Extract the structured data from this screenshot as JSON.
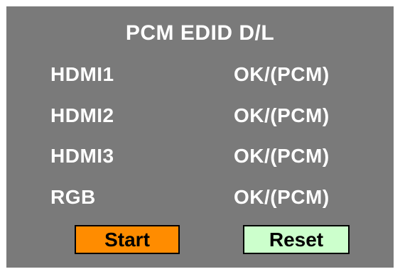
{
  "panel": {
    "title": "PCM EDID D/L",
    "background": "#7a7a7a"
  },
  "rows": [
    {
      "port": "HDMI1",
      "status": "OK/(PCM)"
    },
    {
      "port": "HDMI2",
      "status": "OK/(PCM)"
    },
    {
      "port": "HDMI3",
      "status": "OK/(PCM)"
    },
    {
      "port": "RGB",
      "status": "OK/(PCM)"
    }
  ],
  "buttons": {
    "start_label": "Start",
    "start_color": "#ff8c00",
    "reset_label": "Reset",
    "reset_color": "#ccffcc"
  }
}
